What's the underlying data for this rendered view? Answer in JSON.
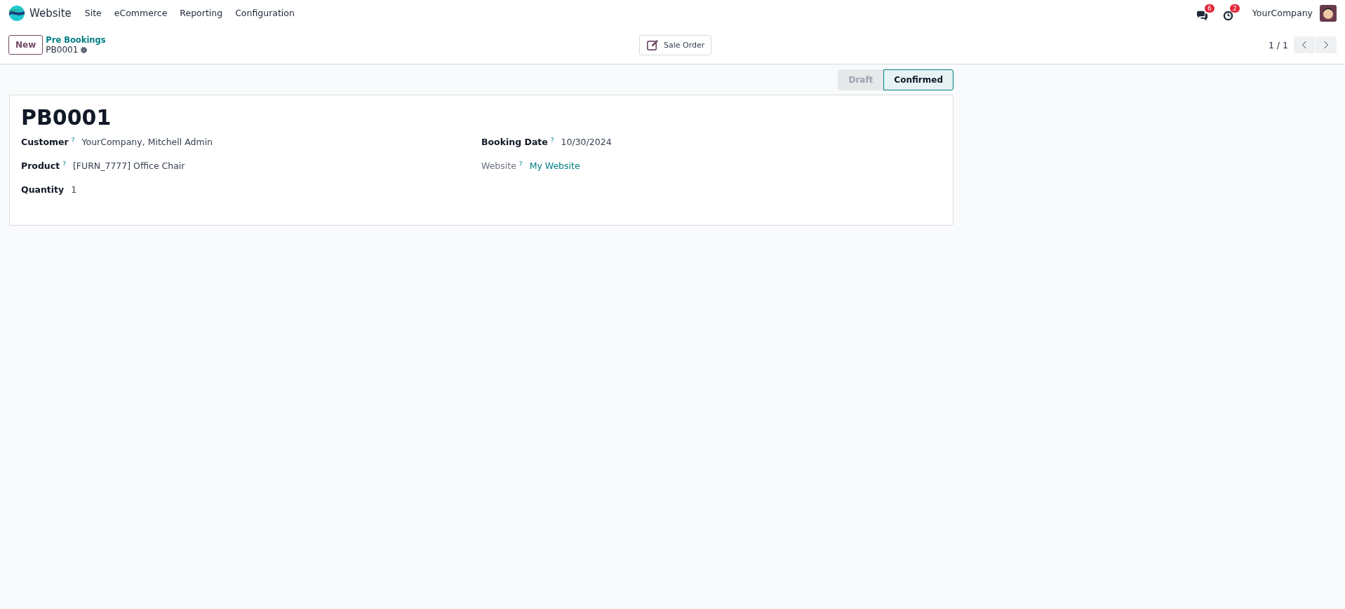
{
  "navbar": {
    "app_name": "Website",
    "menu": [
      "Site",
      "eCommerce",
      "Reporting",
      "Configuration"
    ],
    "messages_count": "6",
    "activities_count": "2",
    "company": "YourCompany"
  },
  "control_panel": {
    "new_button": "New",
    "breadcrumb": "Pre Bookings",
    "record": "PB0001",
    "action_button": "Sale Order",
    "pager": "1 / 1"
  },
  "statusbar": [
    {
      "label": "Draft",
      "selected": false
    },
    {
      "label": "Confirmed",
      "selected": true
    }
  ],
  "form": {
    "title": "PB0001",
    "left_fields": [
      {
        "label": "Customer",
        "help": "?",
        "value": "YourCompany, Mitchell Admin",
        "required": true,
        "link": false
      },
      {
        "label": "Product",
        "help": "?",
        "value": "[FURN_7777] Office Chair",
        "required": true,
        "link": false
      },
      {
        "label": "Quantity",
        "value": "1",
        "required": true,
        "link": false
      }
    ],
    "right_fields": [
      {
        "label": "Booking Date",
        "help": "?",
        "value": "10/30/2024",
        "required": true,
        "link": false
      },
      {
        "label": "Website",
        "help": "?",
        "value": "My Website",
        "required": false,
        "link": true
      }
    ]
  }
}
